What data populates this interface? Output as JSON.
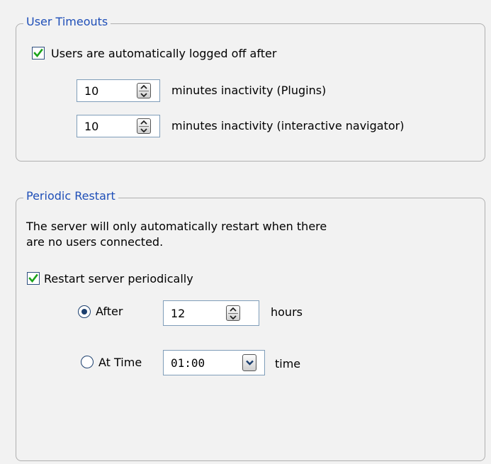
{
  "user_timeouts": {
    "legend": "User Timeouts",
    "logoff_checkbox": {
      "label": "Users are automatically logged off after",
      "checked": true
    },
    "rows": [
      {
        "value": "10",
        "label": "minutes inactivity (Plugins)"
      },
      {
        "value": "10",
        "label": "minutes inactivity (interactive navigator)"
      }
    ]
  },
  "periodic_restart": {
    "legend": "Periodic Restart",
    "description_line1": "The server will only automatically restart when there",
    "description_line2": "are no users connected.",
    "restart_checkbox": {
      "label": "Restart server periodically",
      "checked": true
    },
    "after": {
      "label": "After",
      "selected": true,
      "value": "12",
      "unit": "hours"
    },
    "at_time": {
      "label": "At Time",
      "selected": false,
      "value": "01:00",
      "unit": "time"
    }
  },
  "colors": {
    "legend_text": "#1f4fb8",
    "check_mark": "#1aa31a",
    "group_border": "#b0b0b0",
    "background": "#f2f2f2"
  }
}
